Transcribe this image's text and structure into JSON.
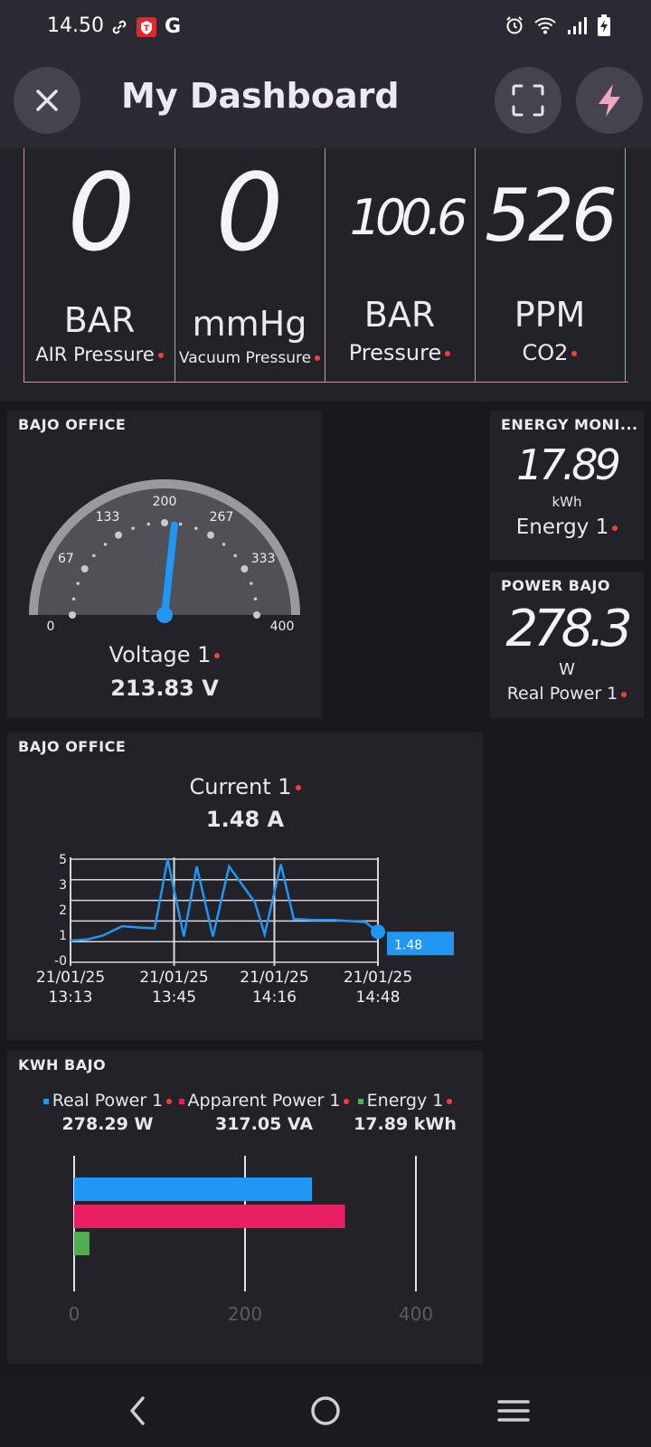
{
  "status_bar": {
    "time": "14.50",
    "g_label": "G",
    "icons": [
      "link-icon",
      "app-notification-icon",
      "google-icon",
      "alarm-icon",
      "wifi-icon",
      "signal-icon",
      "battery-charging-icon"
    ]
  },
  "app_bar": {
    "title": "My Dashboard",
    "icons": [
      "close-icon",
      "fullscreen-icon",
      "lightning-icon"
    ]
  },
  "top_tiles": [
    {
      "value": "0",
      "unit": "BAR",
      "label": "AIR Pressure"
    },
    {
      "value": "0",
      "unit": "mmHg",
      "label": "Vacuum Pressure"
    },
    {
      "value": "100.6",
      "unit": "BAR",
      "label": "Pressure"
    },
    {
      "value": "526",
      "unit": "PPM",
      "label": "CO2"
    }
  ],
  "gauge_card": {
    "title": "BAJO OFFICE",
    "label": "Voltage 1",
    "value_text": "213.83 V",
    "value": 213.83,
    "min": 0,
    "max": 400,
    "ticks": [
      "0",
      "67",
      "133",
      "200",
      "267",
      "333",
      "400"
    ]
  },
  "energy_card": {
    "title": "ENERGY MONI...",
    "value": "17.89",
    "unit": "kWh",
    "label": "Energy 1"
  },
  "power_card": {
    "title": "POWER BAJO",
    "value": "278.3",
    "unit": "W",
    "label": "Real Power 1"
  },
  "current_card": {
    "title": "BAJO OFFICE",
    "label": "Current 1",
    "value_text": "1.48 A"
  },
  "kwh_card": {
    "title": "KWH BAJO",
    "legend": [
      {
        "name": "Real Power 1",
        "value_text": "278.29 W",
        "color": "#2196f3"
      },
      {
        "name": "Apparent Power 1",
        "value_text": "317.05 VA",
        "color": "#e91e63"
      },
      {
        "name": "Energy 1",
        "value_text": "17.89 kWh",
        "color": "#4caf50"
      }
    ]
  },
  "chart_data": [
    {
      "type": "line",
      "y_ticks": [
        "5",
        "3",
        "2",
        "1",
        "-0"
      ],
      "x_ticks": [
        {
          "date": "21/01/25",
          "time": "13:13"
        },
        {
          "date": "21/01/25",
          "time": "13:45"
        },
        {
          "date": "21/01/25",
          "time": "14:16"
        },
        {
          "date": "21/01/25",
          "time": "14:48"
        }
      ],
      "series": [
        {
          "color": "#2196f3",
          "points": [
            [
              "13:13",
              1.05
            ],
            [
              "13:18",
              1.1
            ],
            [
              "13:23",
              1.3
            ],
            [
              "13:29",
              1.75
            ],
            [
              "13:35",
              1.68
            ],
            [
              "13:39",
              1.65
            ],
            [
              "13:43",
              5.0
            ],
            [
              "13:48",
              1.25
            ],
            [
              "13:52",
              4.65
            ],
            [
              "13:57",
              1.25
            ],
            [
              "14:02",
              4.65
            ],
            [
              "14:10",
              2.9
            ],
            [
              "14:13",
              1.35
            ],
            [
              "14:18",
              4.75
            ],
            [
              "14:22",
              2.1
            ],
            [
              "14:28",
              2.05
            ],
            [
              "14:34",
              2.05
            ],
            [
              "14:44",
              1.95
            ],
            [
              "14:48",
              1.48
            ]
          ]
        }
      ],
      "last_value_label": "1.48"
    },
    {
      "type": "bar",
      "orientation": "horizontal",
      "categories": [
        "Real Power 1",
        "Apparent Power 1",
        "Energy 1"
      ],
      "values": [
        278.29,
        317.05,
        17.89
      ],
      "colors": [
        "#2196f3",
        "#e91e63",
        "#4caf50"
      ],
      "x_ticks": [
        "0",
        "200",
        "400"
      ],
      "xlim": [
        0,
        400
      ]
    }
  ]
}
